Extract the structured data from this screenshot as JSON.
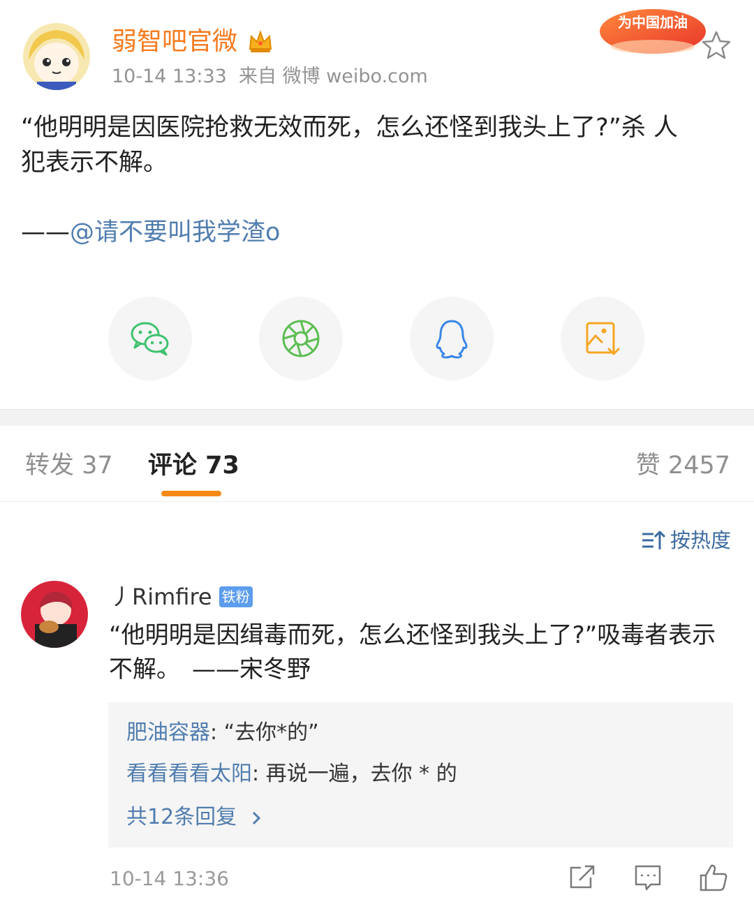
{
  "post": {
    "author": "弱智吧官微",
    "time": "10-14 13:33",
    "source": "来自 微博 weibo.com",
    "badge_text": "为中国加油",
    "text_line1": "“他明明是因医院抢救无效而死，怎么还怪到我头上了?”杀 人",
    "text_line2": "犯表示不解。",
    "dash": "——",
    "mention": "@请不要叫我学渣o"
  },
  "share": [
    {
      "name": "wechat",
      "icon": "wechat-icon"
    },
    {
      "name": "moments",
      "icon": "moments-icon"
    },
    {
      "name": "qq",
      "icon": "qq-icon"
    },
    {
      "name": "save-image",
      "icon": "save-image-icon"
    }
  ],
  "tabs": {
    "repost": "转发 37",
    "comment": "评论 73",
    "like": "赞 2457"
  },
  "sort": {
    "label": "按热度"
  },
  "comment": {
    "user": "丿Rimfire",
    "badge": "铁粉",
    "text": "“他明明是因缉毒而死，怎么还怪到我头上了?”吸毒者表示不解。　——宋冬野",
    "replies": [
      {
        "name": "肥油容器",
        "text": ": “去你*的”"
      },
      {
        "name": "看看看看太阳",
        "text": ": 再说一遍，去你 * 的"
      }
    ],
    "more": "共12条回复",
    "time": "10-14 13:36"
  },
  "colors": {
    "orange": "#f77b1e",
    "link": "#507daf",
    "indicator": "#f78a16",
    "wechat": "#3ec26e",
    "moments": "#5bbd52",
    "qq": "#3a86e8",
    "save": "#f5a623"
  }
}
